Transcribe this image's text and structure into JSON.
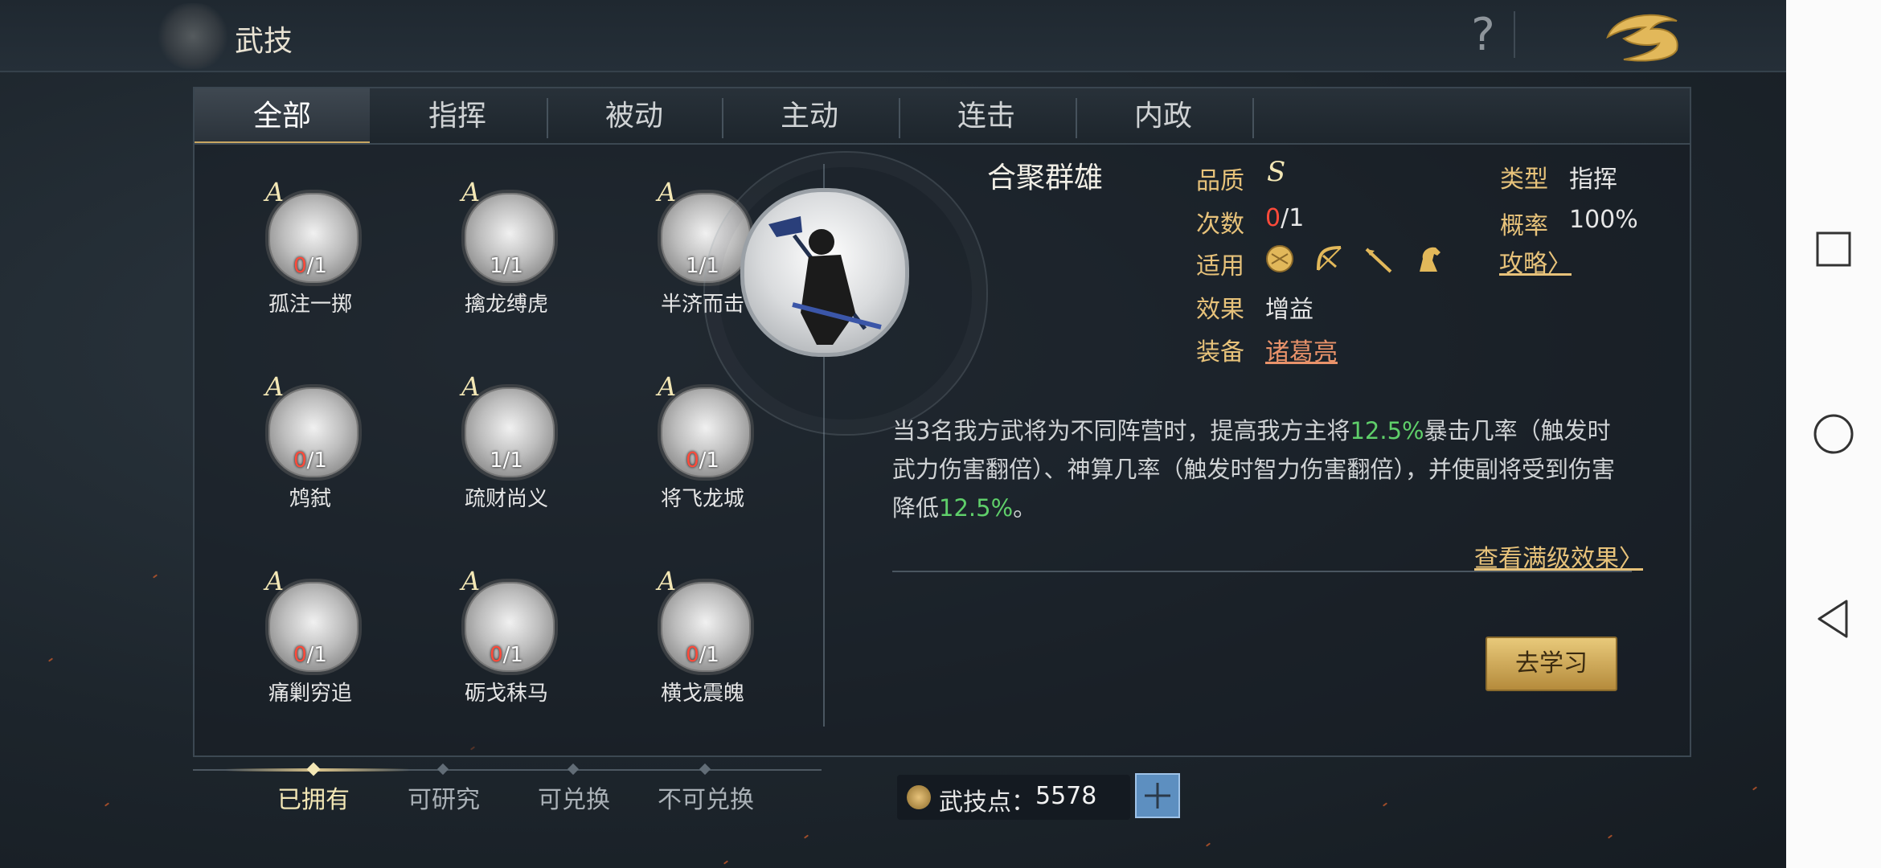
{
  "header": {
    "title": "武技",
    "help_label": "?"
  },
  "tabs": [
    {
      "label": "全部",
      "active": true
    },
    {
      "label": "指挥"
    },
    {
      "label": "被动"
    },
    {
      "label": "主动"
    },
    {
      "label": "连击"
    },
    {
      "label": "内政"
    }
  ],
  "skills": [
    {
      "grade": "A",
      "have": "0",
      "total": "/1",
      "name": "孤注一掷"
    },
    {
      "grade": "A",
      "have": "1",
      "total": "/1",
      "name": "擒龙缚虎"
    },
    {
      "grade": "A",
      "have": "1",
      "total": "/1",
      "name": "半济而击"
    },
    {
      "grade": "A",
      "have": "0",
      "total": "/1",
      "name": "鸩弑"
    },
    {
      "grade": "A",
      "have": "1",
      "total": "/1",
      "name": "疏财尚义"
    },
    {
      "grade": "A",
      "have": "0",
      "total": "/1",
      "name": "将飞龙城"
    },
    {
      "grade": "A",
      "have": "0",
      "total": "/1",
      "name": "痛剿穷追"
    },
    {
      "grade": "A",
      "have": "0",
      "total": "/1",
      "name": "砺戈秣马"
    },
    {
      "grade": "A",
      "have": "0",
      "total": "/1",
      "name": "横戈震魄"
    }
  ],
  "detail": {
    "name": "合聚群雄",
    "quality_label": "品质",
    "quality_value": "S",
    "count_label": "次数",
    "count_have": "0",
    "count_total": "/1",
    "apply_label": "适用",
    "apply_icons": [
      "shield-icon",
      "bow-icon",
      "spear-icon",
      "horse-icon"
    ],
    "effect_label": "效果",
    "effect_value": "增益",
    "equip_label": "装备",
    "equip_value": "诸葛亮",
    "type_label": "类型",
    "type_value": "指挥",
    "rate_label": "概率",
    "rate_value": "100%",
    "guide_link": "攻略〉",
    "desc_1": "当3名我方武将为不同阵营时，提高我方主将",
    "desc_hl_1": "12.5%",
    "desc_2": "暴击几率（触发时武力伤害翻倍）、神算几率（触发时智力伤害翻倍），并使副将受到伤害降低",
    "desc_hl_2": "12.5%",
    "desc_3": "。",
    "full_effect_link": "查看满级效果〉",
    "learn_button": "去学习"
  },
  "filters": [
    {
      "label": "已拥有",
      "active": true
    },
    {
      "label": "可研究"
    },
    {
      "label": "可兑换"
    },
    {
      "label": "不可兑换"
    }
  ],
  "points": {
    "label": "武技点：",
    "value": "5578",
    "add_label": "+"
  },
  "colors": {
    "accent_gold": "#e7c27a",
    "highlight_green": "#5fcf6a",
    "missing_red": "#ff4a3a",
    "button_gold": "#d4ad5a"
  }
}
